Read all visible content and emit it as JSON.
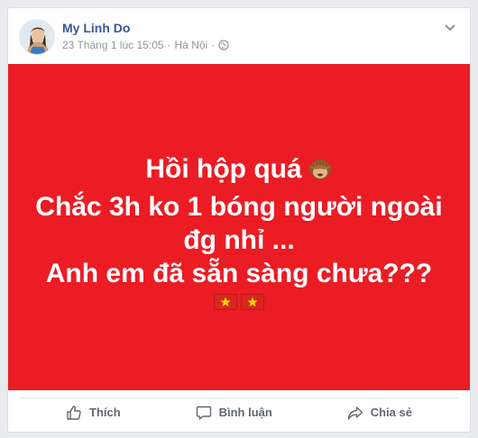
{
  "post": {
    "author": "My Linh Do",
    "timestamp": "23 Tháng 1 lúc 15:05",
    "separator": "·",
    "location": "Hà Nội",
    "separator2": "·",
    "privacy_icon": "globe-icon"
  },
  "banner": {
    "background_color": "#eb1c24",
    "lines": [
      "Hồi hộp quá",
      "Chắc 3h ko 1 bóng người ngoài",
      "đg nhỉ ...",
      "Anh em đã sẵn sàng chưa???"
    ],
    "emoji": "see-no-evil-monkey",
    "flags": [
      "vietnam-flag",
      "vietnam-flag"
    ]
  },
  "actions": {
    "like_label": "Thích",
    "comment_label": "Bình luận",
    "share_label": "Chia sẻ"
  }
}
